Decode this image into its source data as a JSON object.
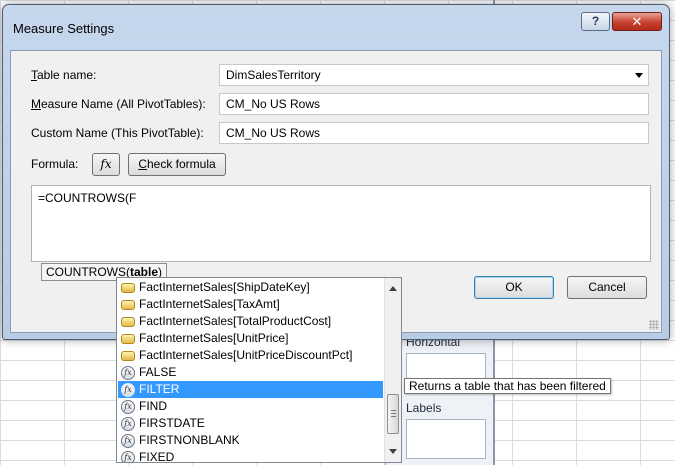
{
  "window": {
    "title": "Measure Settings",
    "help_glyph": "?",
    "close_glyph": "✕"
  },
  "form": {
    "table_name_label_key": "T",
    "table_name_label_rest": "able name:",
    "table_name_value": "DimSalesTerritory",
    "measure_name_label_key": "M",
    "measure_name_label_rest": "easure Name (All PivotTables):",
    "measure_name_value": "CM_No US Rows",
    "custom_name_label": "Custom Name (This PivotTable):",
    "custom_name_value": "CM_No US Rows",
    "formula_label": "Formula:",
    "fx_label": "fx",
    "check_formula_key": "C",
    "check_formula_rest": "heck formula",
    "formula_text": "=COUNTROWS(F",
    "signature_fn": "COUNTROWS(",
    "signature_param": "table",
    "signature_end": ")"
  },
  "buttons": {
    "ok": "OK",
    "cancel": "Cancel"
  },
  "autocomplete": {
    "items": [
      {
        "label": "FactInternetSales[ShipDateKey]",
        "kind": "column"
      },
      {
        "label": "FactInternetSales[TaxAmt]",
        "kind": "column"
      },
      {
        "label": "FactInternetSales[TotalProductCost]",
        "kind": "column"
      },
      {
        "label": "FactInternetSales[UnitPrice]",
        "kind": "column"
      },
      {
        "label": "FactInternetSales[UnitPriceDiscountPct]",
        "kind": "column"
      },
      {
        "label": "FALSE",
        "kind": "function"
      },
      {
        "label": "FILTER",
        "kind": "function",
        "selected": true
      },
      {
        "label": "FIND",
        "kind": "function"
      },
      {
        "label": "FIRSTDATE",
        "kind": "function"
      },
      {
        "label": "FIRSTNONBLANK",
        "kind": "function"
      },
      {
        "label": "FIXED",
        "kind": "function"
      }
    ],
    "tooltip": "Returns a table that has been filtered"
  },
  "background": {
    "pane_label_horizontal": "Horizontal",
    "pane_label_labels": "Labels"
  }
}
